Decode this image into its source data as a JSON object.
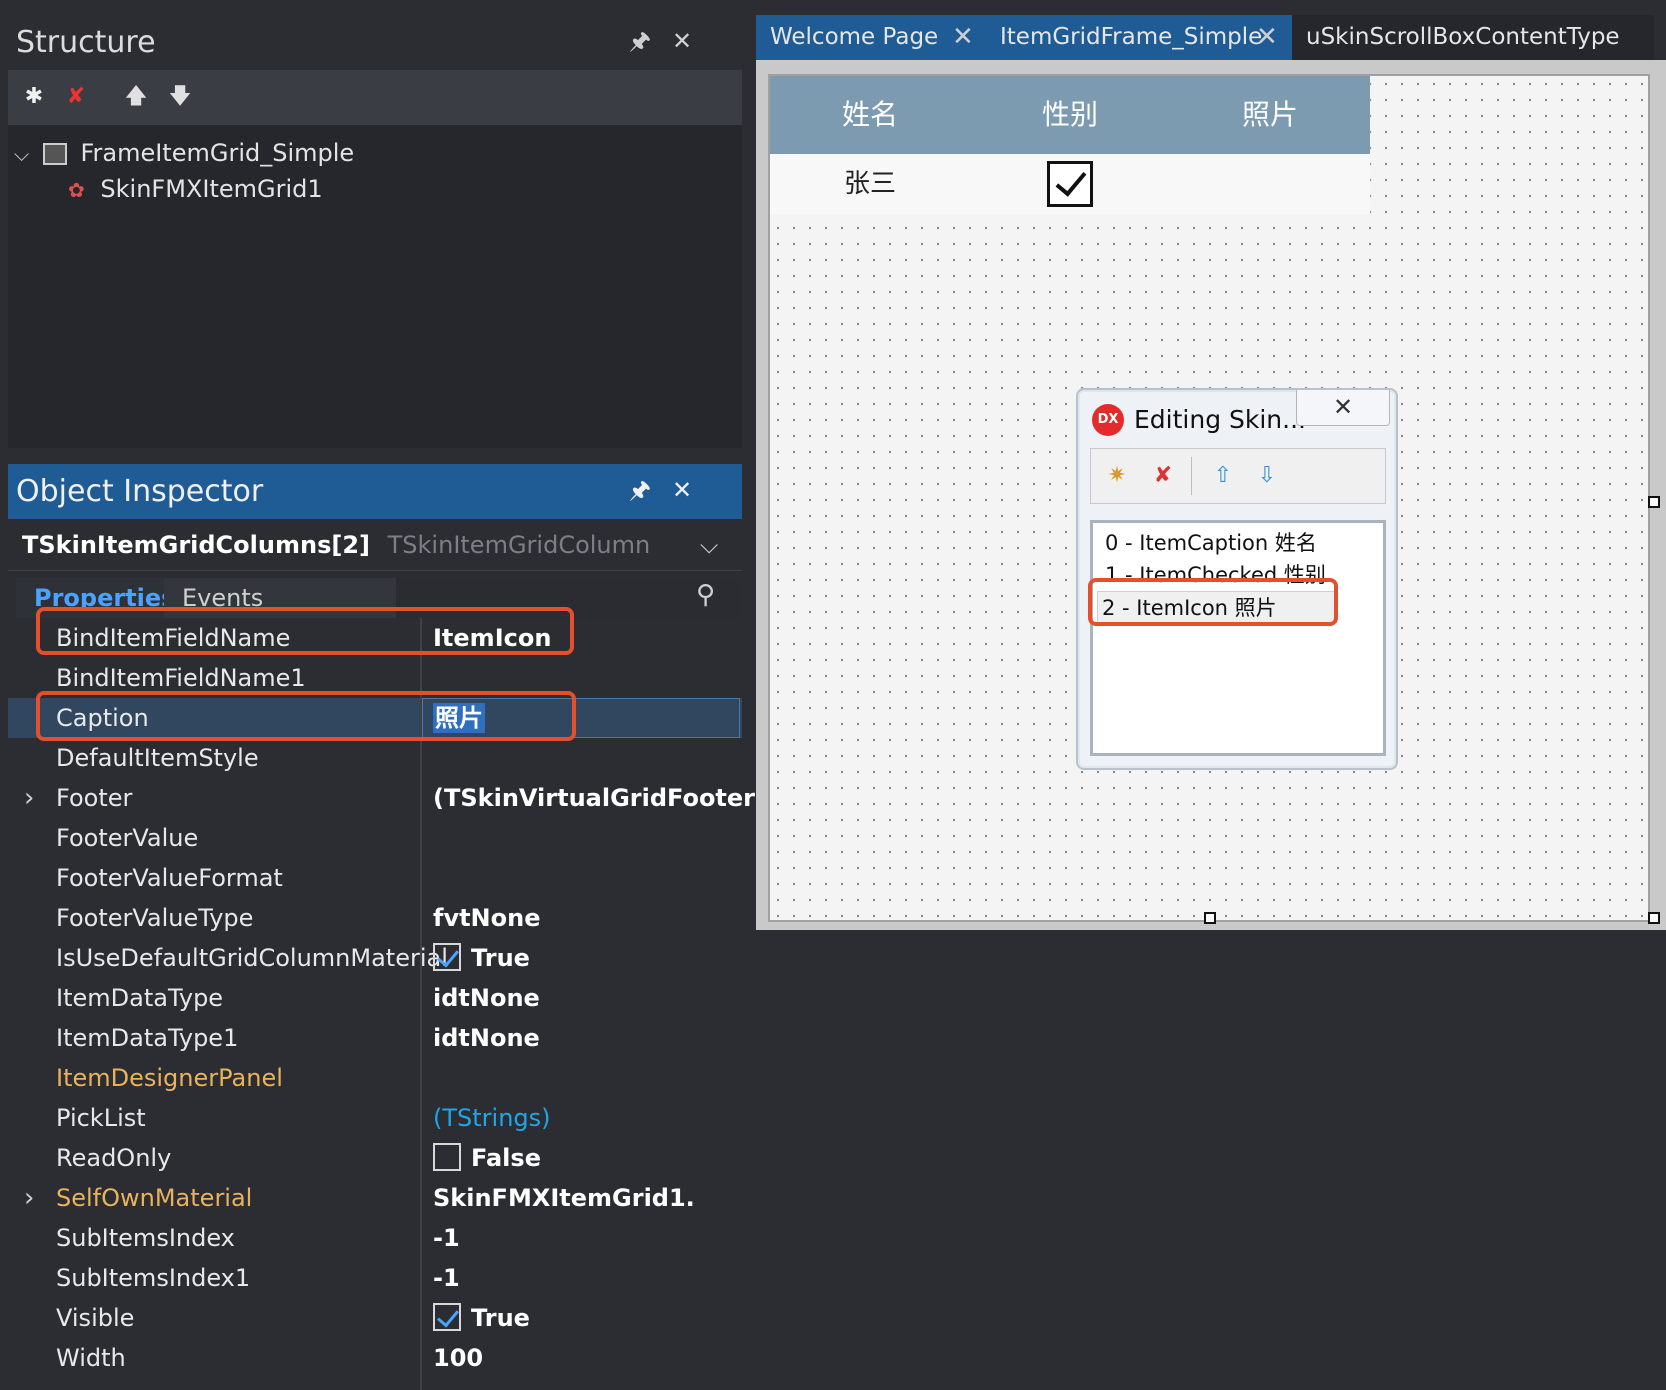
{
  "structure": {
    "title": "Structure",
    "pin_icon": "pin-icon",
    "close_icon": "close-icon",
    "tree": [
      {
        "label": "FrameItemGrid_Simple",
        "level": 0,
        "expanded": true
      },
      {
        "label": "SkinFMXItemGrid1",
        "level": 1
      }
    ]
  },
  "inspector": {
    "title": "Object Inspector",
    "selected_object": "TSkinItemGridColumns[2]",
    "selected_type": "TSkinItemGridColumn",
    "tabs": [
      "Properties",
      "Events"
    ],
    "active_tab": "Properties",
    "properties": [
      {
        "name": "BindItemFieldName",
        "value": "ItemIcon",
        "highlight": true
      },
      {
        "name": "BindItemFieldName1",
        "value": ""
      },
      {
        "name": "Caption",
        "value": "照片",
        "selected": true,
        "highlight": true
      },
      {
        "name": "DefaultItemStyle",
        "value": ""
      },
      {
        "name": "Footer",
        "value": "(TSkinVirtualGridFooter)",
        "expandable": true
      },
      {
        "name": "FooterValue",
        "value": ""
      },
      {
        "name": "FooterValueFormat",
        "value": ""
      },
      {
        "name": "FooterValueType",
        "value": "fvtNone"
      },
      {
        "name": "IsUseDefaultGridColumnMaterial",
        "value": "True",
        "checkbox": true,
        "checked": true
      },
      {
        "name": "ItemDataType",
        "value": "idtNone"
      },
      {
        "name": "ItemDataType1",
        "value": "idtNone"
      },
      {
        "name": "ItemDesignerPanel",
        "value": "",
        "orange": true
      },
      {
        "name": "PickList",
        "value": "(TStrings)",
        "link": true
      },
      {
        "name": "ReadOnly",
        "value": "False",
        "checkbox": true,
        "checked": false
      },
      {
        "name": "SelfOwnMaterial",
        "value": "SkinFMXItemGrid1.",
        "orange": true,
        "expandable": true
      },
      {
        "name": "SubItemsIndex",
        "value": "-1"
      },
      {
        "name": "SubItemsIndex1",
        "value": "-1"
      },
      {
        "name": "Visible",
        "value": "True",
        "checkbox": true,
        "checked": true
      },
      {
        "name": "Width",
        "value": "100"
      }
    ]
  },
  "editor_tabs": [
    {
      "label": "Welcome Page",
      "closable": true
    },
    {
      "label": "ItemGridFrame_Simple",
      "closable": true,
      "active": true
    },
    {
      "label": "uSkinScrollBoxContentType",
      "closable": false
    }
  ],
  "grid": {
    "headers": [
      "姓名",
      "性别",
      "照片"
    ],
    "row": {
      "name": "张三",
      "checked": true,
      "photo": ""
    },
    "header_color": "#7c9bb1"
  },
  "dialog": {
    "logo": "DX",
    "title": "Editing Skin...",
    "items": [
      "0 - ItemCaption 姓名",
      "1 - ItemChecked 性别",
      "2 - ItemIcon 照片"
    ],
    "selected_index": 2
  },
  "colors": {
    "accent": "#1f5c96",
    "highlight_box": "#e5502c",
    "link": "#1ea7e8",
    "orange_prop": "#e8b35a"
  }
}
